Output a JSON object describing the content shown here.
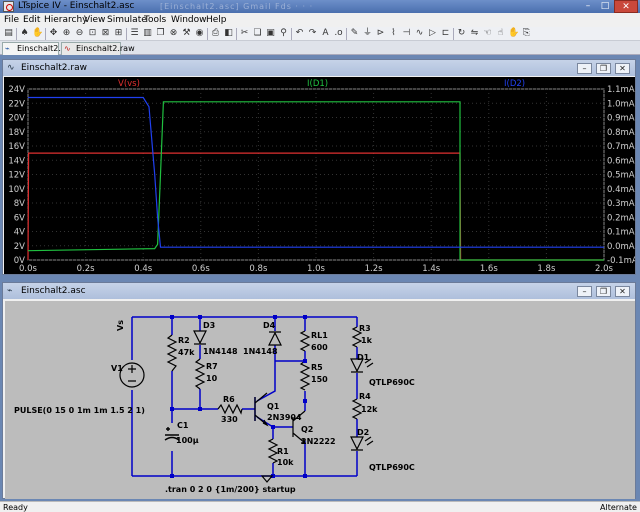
{
  "window": {
    "title": "LTspice IV - Einschalt2.asc",
    "ghost_tabs": "[Einschalt2.asc]  Gmail  Fds  · ·  ·"
  },
  "menu": [
    "File",
    "Edit",
    "Hierarchy",
    "View",
    "Simulate",
    "Tools",
    "Window",
    "Help"
  ],
  "toolbar_icons": [
    "open-icon",
    "run-icon",
    "halt-icon",
    "pan-icon",
    "zoom-in-icon",
    "zoom-out-icon",
    "zoom-fit-icon",
    "zoom-full-icon",
    "autorange-icon",
    "tile-horizontal-icon",
    "tile-vertical-icon",
    "cascade-icon",
    "close-all-icon",
    "control-panel-icon",
    "pick-visible-traces-icon",
    "print-icon",
    "print-preview-icon",
    "cut-icon",
    "copy-icon",
    "paste-icon",
    "find-icon",
    "undo-icon",
    "redo-icon",
    "text-icon",
    "spice-directive-icon",
    "wire-icon",
    "ground-icon",
    "label-icon",
    "resistor-icon",
    "capacitor-icon",
    "inductor-icon",
    "diode-icon",
    "component-icon",
    "rotate-icon",
    "mirror-icon",
    "drag-icon",
    "move-icon",
    "delete-icon",
    "duplicate-icon"
  ],
  "tabs": [
    {
      "label": "Einschalt2.asc",
      "icon": "schematic-icon"
    },
    {
      "label": "Einschalt2.raw",
      "icon": "waveform-icon"
    }
  ],
  "waveform_window": {
    "title": "Einschalt2.raw",
    "chart_data": {
      "type": "line",
      "x_ticks": [
        "0.0s",
        "0.2s",
        "0.4s",
        "0.6s",
        "0.8s",
        "1.0s",
        "1.2s",
        "1.4s",
        "1.6s",
        "1.8s",
        "2.0s"
      ],
      "xlim": [
        0,
        2.0
      ],
      "left_ticks": [
        "24V",
        "22V",
        "20V",
        "18V",
        "16V",
        "14V",
        "12V",
        "10V",
        "8V",
        "6V",
        "4V",
        "2V",
        "0V"
      ],
      "left_ylim": [
        0,
        24
      ],
      "right_ticks": [
        "1.1mA",
        "1.0mA",
        "0.9mA",
        "0.8mA",
        "0.7mA",
        "0.6mA",
        "0.5mA",
        "0.4mA",
        "0.3mA",
        "0.2mA",
        "0.1mA",
        "0.0mA",
        "-0.1mA"
      ],
      "right_ylim": [
        -0.1,
        1.1
      ],
      "series": [
        {
          "name": "V(vs)",
          "color": "#e03030",
          "axis": "left",
          "x": [
            0,
            0.002,
            1.5,
            1.502,
            2.0
          ],
          "y": [
            0,
            15,
            15,
            0,
            0
          ]
        },
        {
          "name": "I(D1)",
          "color": "#20c040",
          "axis": "left",
          "x": [
            0,
            0.44,
            0.45,
            0.46,
            0.47,
            1.5,
            1.5,
            2.0
          ],
          "y": [
            1.3,
            1.6,
            2.2,
            12,
            22.2,
            22.2,
            0,
            0
          ]
        },
        {
          "name": "I(D2)",
          "color": "#2040f0",
          "axis": "left",
          "x": [
            0,
            0.4,
            0.42,
            0.44,
            0.45,
            0.46,
            2.0
          ],
          "y": [
            22.8,
            22.8,
            21.5,
            12,
            6,
            1.8,
            1.8
          ]
        }
      ]
    }
  },
  "schematic_window": {
    "title": "Einschalt2.asc",
    "labels": {
      "vs": "Vs",
      "v1": "V1",
      "pulse": "PULSE(0 15 0 1m 1m 1.5 2 1)",
      "r2": "R2",
      "r2v": "47k",
      "d3": "D3",
      "d3v": "1N4148",
      "r7": "R7",
      "r7v": "10",
      "c1": "C1",
      "c1v": "100µ",
      "r6": "R6",
      "r6v": "330",
      "q1": "Q1",
      "q1v": "2N3904",
      "d4": "D4",
      "d4v": "1N4148",
      "r1": "R1",
      "r1v": "10k",
      "q2": "Q2",
      "q2v": "2N2222",
      "rl1": "RL1",
      "rl1v": "600",
      "r5": "R5",
      "r5v": "150",
      "r3": "R3",
      "r3v": "1k",
      "d1": "D1",
      "d1v": "QTLP690C",
      "r4": "R4",
      "r4v": "12k",
      "d2": "D2",
      "d2v": "QTLP690C",
      "tran": ".tran 0 2 0 {1m/200} startup"
    }
  },
  "status": {
    "left": "Ready",
    "right": "Alternate"
  }
}
